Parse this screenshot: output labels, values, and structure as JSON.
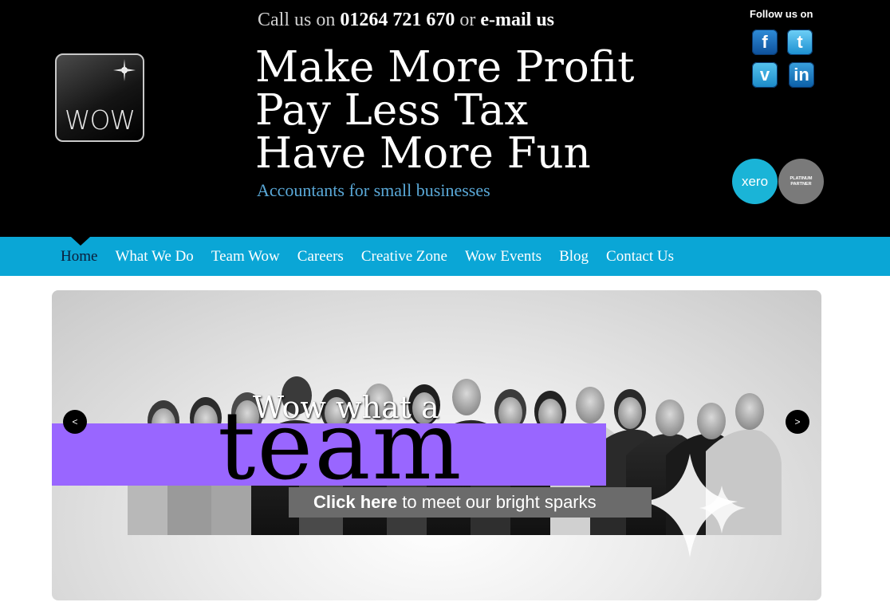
{
  "contact": {
    "prefix": "Call us on",
    "phone": "01264 721 670",
    "joiner": "or",
    "email_link": "e-mail us"
  },
  "logo": {
    "text": "WOW"
  },
  "headline": {
    "line1": "Make More Profit",
    "line2": "Pay Less Tax",
    "line3": "Have More Fun"
  },
  "tagline": "Accountants for small businesses",
  "social": {
    "follow_label": "Follow us on",
    "icons": [
      "facebook-icon",
      "twitter-icon",
      "vimeo-icon",
      "linkedin-icon"
    ],
    "glyphs": {
      "facebook": "f",
      "twitter": "t",
      "vimeo": "v",
      "linkedin": "in"
    }
  },
  "badges": {
    "xero": "xero",
    "partner_line1": "PLATINUM",
    "partner_line2": "PARTNER"
  },
  "nav": {
    "items": [
      {
        "label": "Home",
        "active": true
      },
      {
        "label": "What We Do"
      },
      {
        "label": "Team Wow"
      },
      {
        "label": "Careers"
      },
      {
        "label": "Creative Zone"
      },
      {
        "label": "Wow Events"
      },
      {
        "label": "Blog"
      },
      {
        "label": "Contact Us"
      }
    ]
  },
  "slider": {
    "line1": "Wow what a",
    "big_word": "team",
    "cta_bold": "Click here",
    "cta_rest": "to meet our bright sparks",
    "prev": "<",
    "next": ">"
  },
  "colors": {
    "header_bg": "#000000",
    "nav_bg": "#0aa6d6",
    "tagline": "#5aa9d8",
    "band": "#9966ff",
    "xero": "#1ab4d7"
  }
}
